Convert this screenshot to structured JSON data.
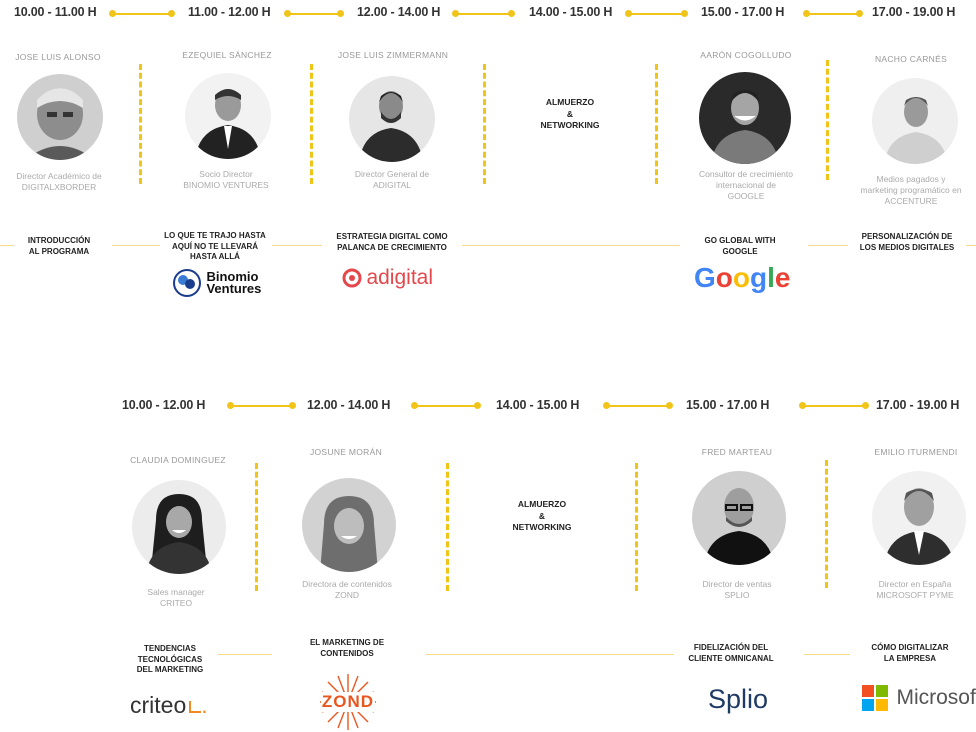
{
  "row1": {
    "times": [
      "10.00 - 11.00 H",
      "11.00 - 12.00 H",
      "12.00 - 14.00 H",
      "14.00 - 15.00 H",
      "15.00 - 17.00 H",
      "17.00 - 19.00 H"
    ],
    "speakers": [
      {
        "name": "JOSE LUIS ALONSO",
        "role": [
          "Director Académico de",
          "DIGITALXBORDER"
        ],
        "topic": [
          "INTRODUCCIÓN",
          "AL PROGRAMA"
        ]
      },
      {
        "name": "EZEQUIEL SÁNCHEZ",
        "role": [
          "Socio Director",
          "BINOMIO VENTURES"
        ],
        "topic": [
          "LO QUE TE TRAJO HASTA",
          "AQUÍ NO TE LLEVARÁ",
          "HASTA ALLÁ"
        ]
      },
      {
        "name": "JOSE LUIS ZIMMERMANN",
        "role": [
          "Director General de",
          "ADIGITAL"
        ],
        "topic": [
          "ESTRATEGIA DIGITAL COMO",
          "PALANCA DE CRECIMIENTO"
        ]
      },
      {
        "name": "AARÓN COGOLLUDO",
        "role": [
          "Consultor de crecimiento",
          "internacional de",
          "GOOGLE"
        ],
        "topic": [
          "GO GLOBAL WITH",
          "GOOGLE"
        ]
      },
      {
        "name": "NACHO CARNÉS",
        "role": [
          "Medios pagados y",
          "marketing programático en",
          "ACCENTURE"
        ],
        "topic": [
          "PERSONALIZACIÓN DE",
          "LOS MEDIOS DIGITALES"
        ]
      }
    ],
    "lunch": [
      "ALMUERZO",
      "&",
      "NETWORKING"
    ]
  },
  "row2": {
    "times": [
      "10.00 - 12.00 H",
      "12.00 - 14.00 H",
      "14.00 - 15.00 H",
      "15.00 - 17.00 H",
      "17.00 - 19.00 H"
    ],
    "speakers": [
      {
        "name": "CLAUDIA DOMINGUEZ",
        "role": [
          "Sales manager",
          "CRITEO"
        ],
        "topic": [
          "TENDENCIAS",
          "TECNOLÓGICAS",
          "DEL MARKETING"
        ]
      },
      {
        "name": "JOSUNE MORÁN",
        "role": [
          "Directora de contenidos",
          "ZOND"
        ],
        "topic": [
          "EL MARKETING DE",
          "CONTENIDOS"
        ]
      },
      {
        "name": "FRED MARTEAU",
        "role": [
          "Director de ventas",
          "SPLIO"
        ],
        "topic": [
          "FIDELIZACIÓN DEL",
          "CLIENTE OMNICANAL"
        ]
      },
      {
        "name": "EMILIO ITURMENDI",
        "role": [
          "Director en España",
          "MICROSOFT PYME"
        ],
        "topic": [
          "CÓMO DIGITALIZAR",
          "LA EMPRESA"
        ]
      }
    ],
    "lunch": [
      "ALMUERZO",
      "&",
      "NETWORKING"
    ]
  },
  "logos": {
    "binomio": [
      "Binomio",
      "Ventures"
    ],
    "adigital": "adigital",
    "google": "Google",
    "criteo": "criteo",
    "zond": "ZOND",
    "splio": "Splio",
    "microsoft": "Microsoft"
  },
  "colors": {
    "accent": "#f0c419",
    "line": "#f5dc8a"
  }
}
